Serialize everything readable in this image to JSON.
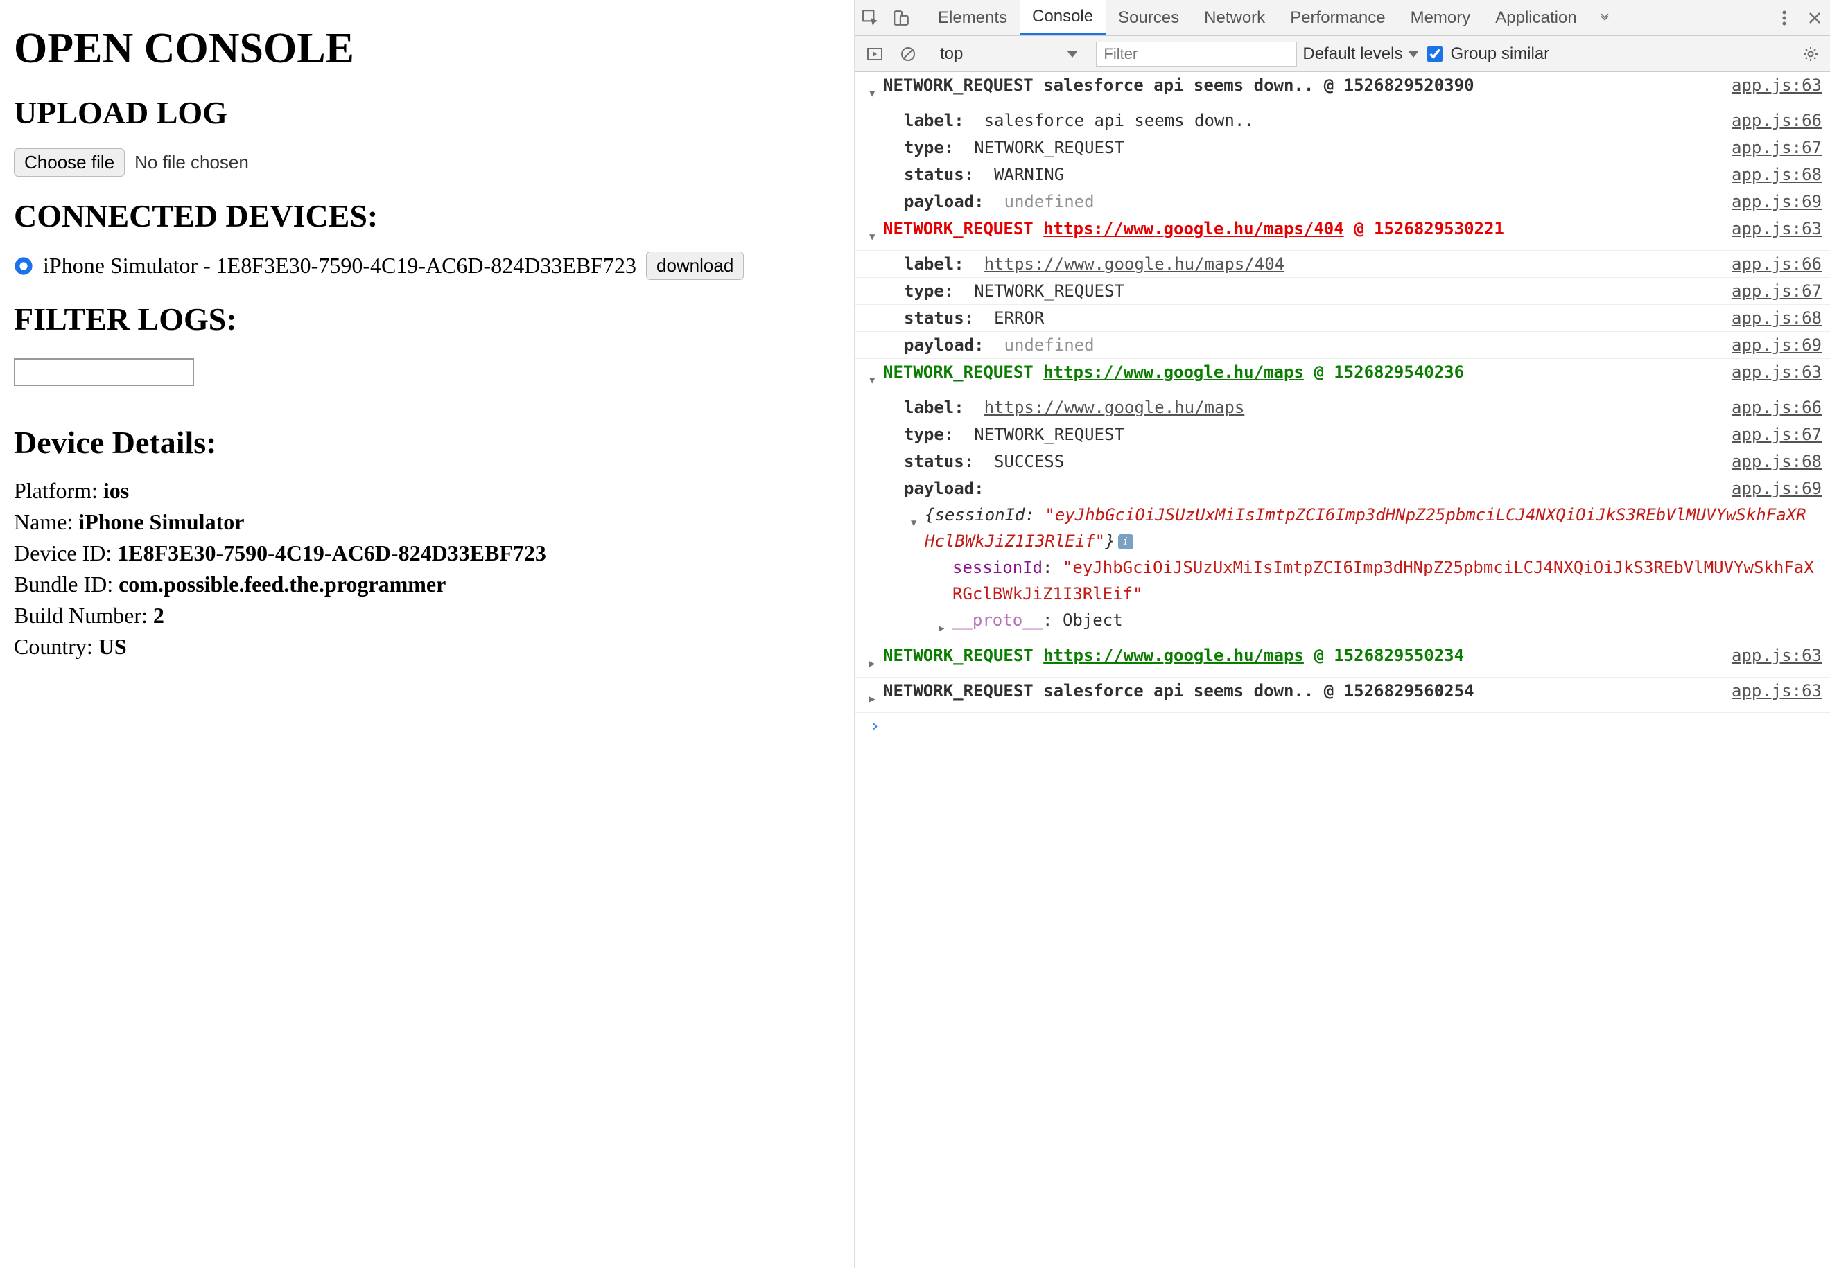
{
  "left": {
    "title": "OPEN CONSOLE",
    "upload_heading": "UPLOAD LOG",
    "choose_file_label": "Choose file",
    "no_file_text": "No file chosen",
    "devices_heading": "CONNECTED DEVICES:",
    "device_label": "iPhone Simulator - 1E8F3E30-7590-4C19-AC6D-824D33EBF723",
    "download_label": "download",
    "filter_heading": "FILTER LOGS:",
    "details_heading": "Device Details:",
    "details": {
      "platform_label": "Platform: ",
      "platform_value": "ios",
      "name_label": "Name: ",
      "name_value": "iPhone Simulator",
      "deviceid_label": "Device ID: ",
      "deviceid_value": "1E8F3E30-7590-4C19-AC6D-824D33EBF723",
      "bundleid_label": "Bundle ID: ",
      "bundleid_value": "com.possible.feed.the.programmer",
      "build_label": "Build Number: ",
      "build_value": "2",
      "country_label": "Country: ",
      "country_value": "US"
    }
  },
  "devtools": {
    "tabs": {
      "elements": "Elements",
      "console": "Console",
      "sources": "Sources",
      "network": "Network",
      "performance": "Performance",
      "memory": "Memory",
      "application": "Application"
    },
    "toolbar": {
      "context": "top",
      "filter_placeholder": "Filter",
      "levels": "Default levels",
      "group_similar": "Group similar"
    },
    "src": {
      "l63": "app.js:63",
      "l66": "app.js:66",
      "l67": "app.js:67",
      "l68": "app.js:68",
      "l69": "app.js:69"
    },
    "logs": {
      "g1": {
        "head_prefix": "NETWORK_REQUEST ",
        "head_label": "salesforce api seems down..",
        "head_ts": " @ 1526829520390",
        "label_k": "label:",
        "label_v": "  salesforce api seems down..",
        "type_k": "type:",
        "type_v": "  NETWORK_REQUEST",
        "status_k": "status:",
        "status_v": "  WARNING",
        "payload_k": "payload:",
        "payload_v": "  undefined"
      },
      "g2": {
        "head_prefix": "NETWORK_REQUEST ",
        "head_url": "https://www.google.hu/maps/404",
        "head_ts": " @ 1526829530221",
        "label_k": "label:",
        "label_url": "https://www.google.hu/maps/404",
        "type_k": "type:",
        "type_v": "  NETWORK_REQUEST",
        "status_k": "status:",
        "status_v": "  ERROR",
        "payload_k": "payload:",
        "payload_v": "  undefined"
      },
      "g3": {
        "head_prefix": "NETWORK_REQUEST ",
        "head_url": "https://www.google.hu/maps",
        "head_ts": " @ 1526829540236",
        "label_k": "label:",
        "label_url": "https://www.google.hu/maps",
        "type_k": "type:",
        "type_v": "  NETWORK_REQUEST",
        "status_k": "status:",
        "status_v": "  SUCCESS",
        "payload_k": "payload:",
        "obj_open": "{",
        "obj_key": "sessionId",
        "obj_colon": ": ",
        "obj_val": "\"eyJhbGciOiJSUzUxMiIsImtpZCI6Imp3dHNpZ25pbmciLCJ4NXQiOiJkS3REbVlMUVYwSkhFaXRHclBWkJiZ1I3RlEif\"",
        "obj_close": "}",
        "sess_key": "sessionId",
        "sess_colon": ": ",
        "sess_val": "\"eyJhbGciOiJSUzUxMiIsImtpZCI6Imp3dHNpZ25pbmciLCJ4NXQiOiJkS3REbVlMUVYwSkhFaXRGclBWkJiZ1I3RlEif\"",
        "proto_key": "__proto__",
        "proto_val": ": Object"
      },
      "g4": {
        "head_prefix": "NETWORK_REQUEST ",
        "head_url": "https://www.google.hu/maps",
        "head_ts": " @ 1526829550234"
      },
      "g5": {
        "head_prefix": "NETWORK_REQUEST ",
        "head_label": "salesforce api seems down..",
        "head_ts": " @ 1526829560254"
      }
    },
    "prompt": "›"
  }
}
